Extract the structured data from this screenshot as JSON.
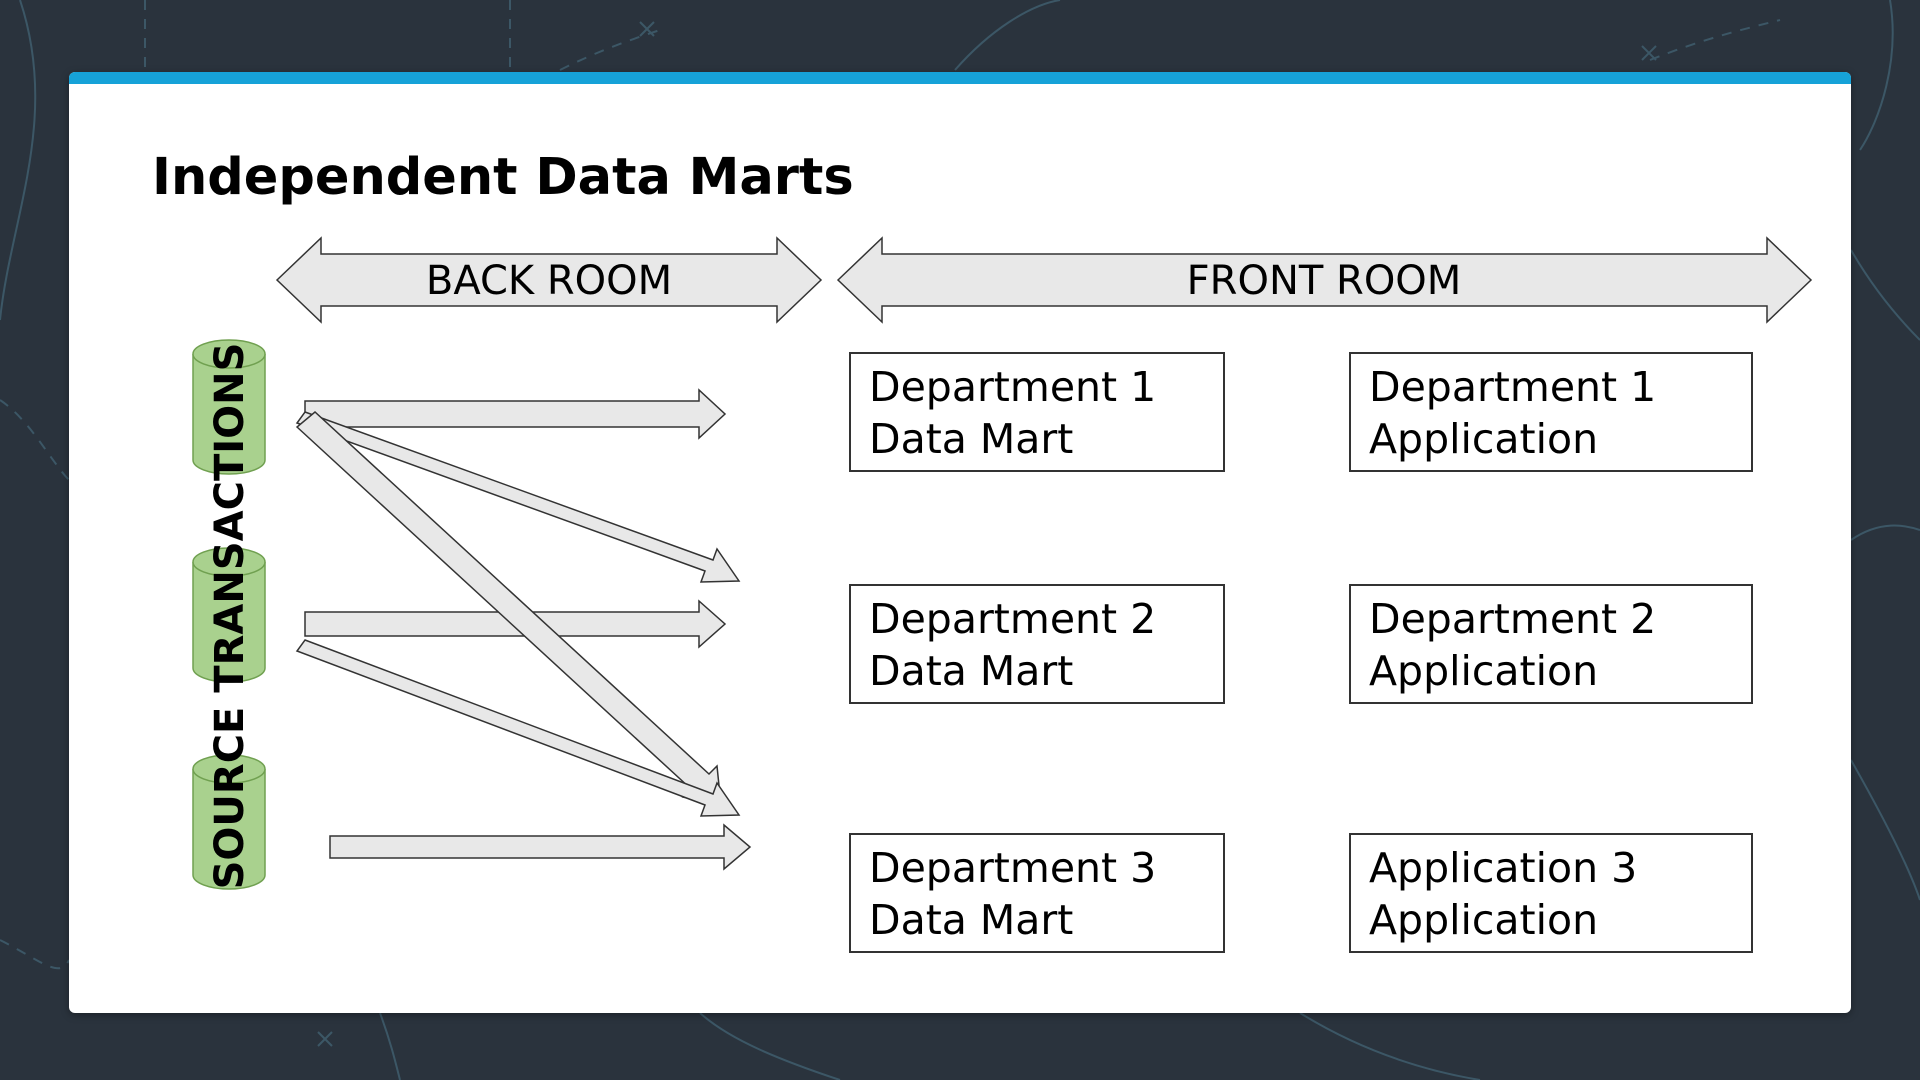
{
  "title": "Independent Data Marts",
  "regions": {
    "back_room": "BACK ROOM",
    "front_room": "FRONT ROOM"
  },
  "source_label": "SOURCE TRANSACTIONS",
  "data_marts": [
    {
      "line1": "Department 1",
      "line2": "Data Mart"
    },
    {
      "line1": "Department 2",
      "line2": "Data Mart"
    },
    {
      "line1": "Department 3",
      "line2": "Data Mart"
    }
  ],
  "applications": [
    {
      "line1": "Department 1",
      "line2": "Application"
    },
    {
      "line1": "Department 2",
      "line2": "Application"
    },
    {
      "line1": "Application 3",
      "line2": "Application"
    }
  ],
  "colors": {
    "background": "#2a333d",
    "accent": "#16a2d8",
    "card": "#ffffff",
    "arrow_fill": "#e8e8e8",
    "cylinder_fill": "#a9d18e",
    "cylinder_stroke": "#70a050"
  }
}
